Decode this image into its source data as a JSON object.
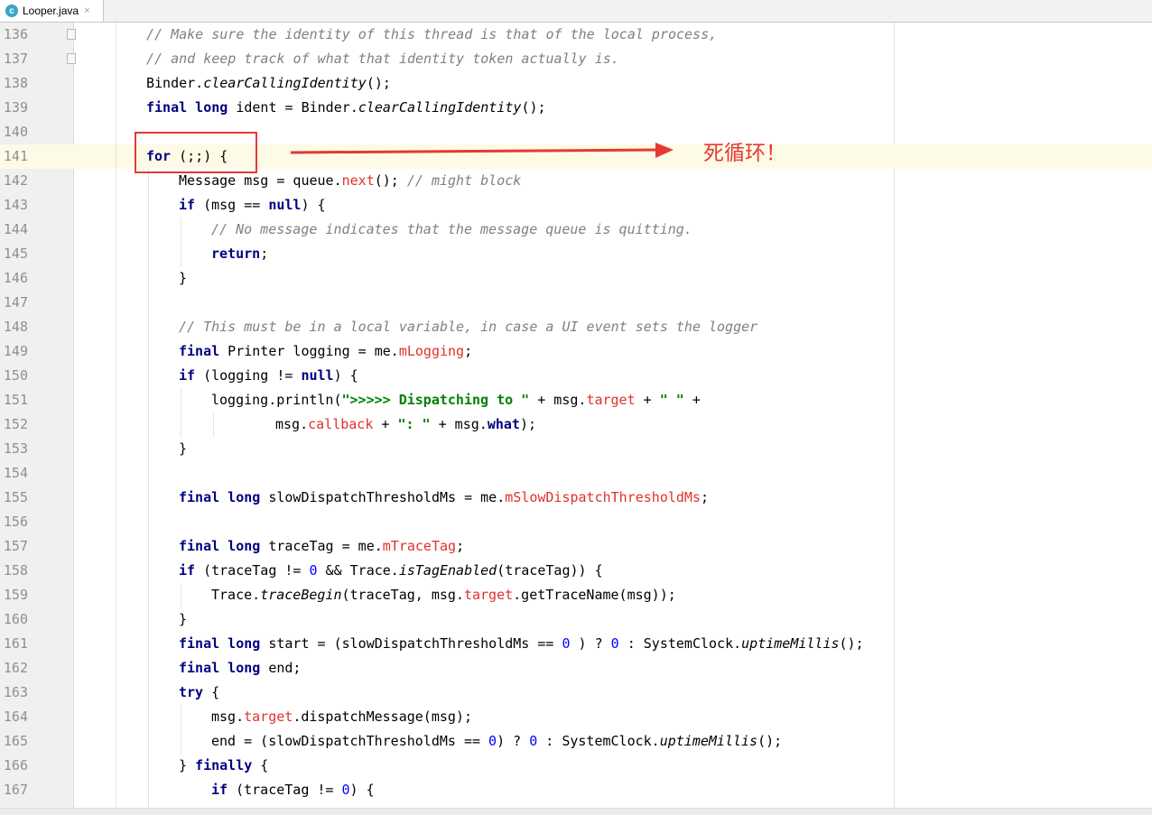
{
  "tab": {
    "title": "Looper.java",
    "icon": "java-class-icon",
    "close": "×"
  },
  "annotation": {
    "text": "死循环！",
    "color": "#e53935"
  },
  "lines": [
    {
      "n": "136",
      "t": [
        [
          "cm",
          "// Make sure the identity of this thread is that of the local process,"
        ]
      ]
    },
    {
      "n": "137",
      "t": [
        [
          "cm",
          "// and keep track of what that identity token actually is."
        ]
      ]
    },
    {
      "n": "138",
      "t": [
        [
          "",
          "Binder."
        ],
        [
          "it",
          "clearCallingIdentity"
        ],
        [
          "",
          "();"
        ]
      ]
    },
    {
      "n": "139",
      "t": [
        [
          "kw",
          "final long"
        ],
        [
          "",
          " ident = Binder."
        ],
        [
          "it",
          "clearCallingIdentity"
        ],
        [
          "",
          "();"
        ]
      ]
    },
    {
      "n": "140",
      "t": []
    },
    {
      "n": "141",
      "t": [
        [
          "kw",
          "for"
        ],
        [
          "",
          " (;;) {"
        ]
      ]
    },
    {
      "n": "142",
      "t": [
        [
          "",
          "Message msg = queue."
        ],
        [
          "fld",
          "next"
        ],
        [
          "",
          "(); "
        ],
        [
          "cm",
          "// might block"
        ]
      ]
    },
    {
      "n": "143",
      "t": [
        [
          "kw",
          "if"
        ],
        [
          "",
          " (msg == "
        ],
        [
          "kw",
          "null"
        ],
        [
          "",
          ") {"
        ]
      ]
    },
    {
      "n": "144",
      "t": [
        [
          "cm",
          "// No message indicates that the message queue is quitting."
        ]
      ]
    },
    {
      "n": "145",
      "t": [
        [
          "kw",
          "return"
        ],
        [
          "",
          ";"
        ]
      ]
    },
    {
      "n": "146",
      "t": [
        [
          "",
          "}"
        ]
      ]
    },
    {
      "n": "147",
      "t": []
    },
    {
      "n": "148",
      "t": [
        [
          "cm",
          "// This must be in a local variable, in case a UI event sets the logger"
        ]
      ]
    },
    {
      "n": "149",
      "t": [
        [
          "kw",
          "final"
        ],
        [
          "",
          " Printer logging = me."
        ],
        [
          "fld",
          "mLogging"
        ],
        [
          "",
          ";"
        ]
      ]
    },
    {
      "n": "150",
      "t": [
        [
          "kw",
          "if"
        ],
        [
          "",
          " (logging != "
        ],
        [
          "kw",
          "null"
        ],
        [
          "",
          ") {"
        ]
      ]
    },
    {
      "n": "151",
      "t": [
        [
          "",
          "logging.println("
        ],
        [
          "str",
          "\">>>>> Dispatching to \""
        ],
        [
          "",
          " + msg."
        ],
        [
          "fld",
          "target"
        ],
        [
          "",
          " + "
        ],
        [
          "str",
          "\" \""
        ],
        [
          "",
          " +"
        ]
      ]
    },
    {
      "n": "152",
      "t": [
        [
          "",
          "msg."
        ],
        [
          "fld",
          "callback"
        ],
        [
          "",
          " + "
        ],
        [
          "str",
          "\": \""
        ],
        [
          "",
          " + msg."
        ],
        [
          "kw",
          "what"
        ],
        [
          "",
          ");"
        ]
      ]
    },
    {
      "n": "153",
      "t": [
        [
          "",
          "}"
        ]
      ]
    },
    {
      "n": "154",
      "t": []
    },
    {
      "n": "155",
      "t": [
        [
          "kw",
          "final long"
        ],
        [
          "",
          " slowDispatchThresholdMs = me."
        ],
        [
          "fld",
          "mSlowDispatchThresholdMs"
        ],
        [
          "",
          ";"
        ]
      ]
    },
    {
      "n": "156",
      "t": []
    },
    {
      "n": "157",
      "t": [
        [
          "kw",
          "final long"
        ],
        [
          "",
          " traceTag = me."
        ],
        [
          "fld",
          "mTraceTag"
        ],
        [
          "",
          ";"
        ]
      ]
    },
    {
      "n": "158",
      "t": [
        [
          "kw",
          "if"
        ],
        [
          "",
          " (traceTag != "
        ],
        [
          "num",
          "0"
        ],
        [
          "",
          " && Trace."
        ],
        [
          "it",
          "isTagEnabled"
        ],
        [
          "",
          "(traceTag)) {"
        ]
      ]
    },
    {
      "n": "159",
      "t": [
        [
          "",
          "Trace."
        ],
        [
          "it",
          "traceBegin"
        ],
        [
          "",
          "(traceTag, msg."
        ],
        [
          "fld",
          "target"
        ],
        [
          "",
          ".getTraceName(msg));"
        ]
      ]
    },
    {
      "n": "160",
      "t": [
        [
          "",
          "}"
        ]
      ]
    },
    {
      "n": "161",
      "t": [
        [
          "kw",
          "final long"
        ],
        [
          "",
          " start = (slowDispatchThresholdMs == "
        ],
        [
          "num",
          "0"
        ],
        [
          "",
          " ) ? "
        ],
        [
          "num",
          "0"
        ],
        [
          "",
          " : SystemClock."
        ],
        [
          "it",
          "uptimeMillis"
        ],
        [
          "",
          "();"
        ]
      ]
    },
    {
      "n": "162",
      "t": [
        [
          "kw",
          "final long"
        ],
        [
          "",
          " end;"
        ]
      ]
    },
    {
      "n": "163",
      "t": [
        [
          "kw",
          "try"
        ],
        [
          "",
          " {"
        ]
      ]
    },
    {
      "n": "164",
      "t": [
        [
          "",
          "msg."
        ],
        [
          "fld",
          "target"
        ],
        [
          "",
          ".dispatchMessage(msg);"
        ]
      ]
    },
    {
      "n": "165",
      "t": [
        [
          "",
          "end = (slowDispatchThresholdMs == "
        ],
        [
          "num",
          "0"
        ],
        [
          "",
          ") ? "
        ],
        [
          "num",
          "0"
        ],
        [
          "",
          " : SystemClock."
        ],
        [
          "it",
          "uptimeMillis"
        ],
        [
          "",
          "();"
        ]
      ]
    },
    {
      "n": "166",
      "t": [
        [
          "",
          "} "
        ],
        [
          "kw",
          "finally"
        ],
        [
          "",
          " {"
        ]
      ]
    },
    {
      "n": "167",
      "t": [
        [
          "kw",
          "if"
        ],
        [
          "",
          " (traceTag != "
        ],
        [
          "num",
          "0"
        ],
        [
          "",
          ") {"
        ]
      ]
    }
  ]
}
